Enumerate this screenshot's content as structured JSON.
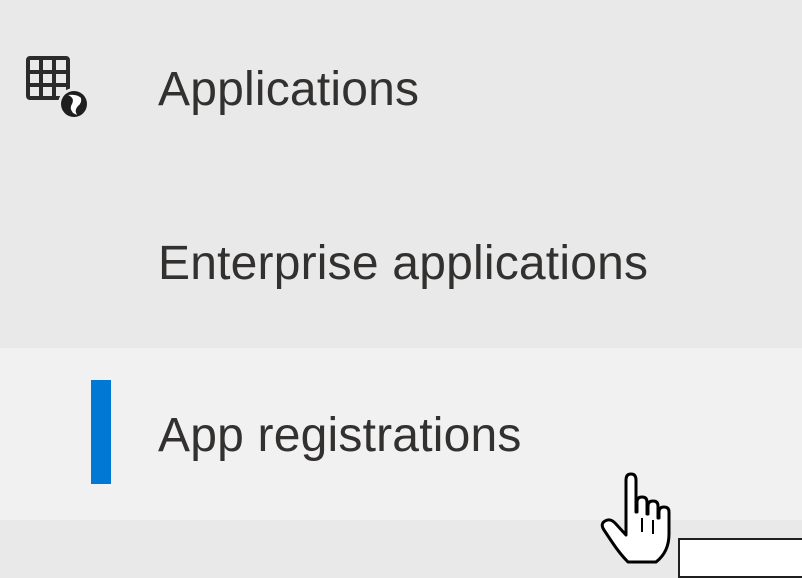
{
  "navigation": {
    "group": {
      "label": "Applications",
      "icon": "applications-globe-icon"
    },
    "items": [
      {
        "label": "Enterprise applications",
        "selected": false
      },
      {
        "label": "App registrations",
        "selected": true
      }
    ]
  },
  "colors": {
    "sidebar_background": "#e9e9e9",
    "hover_background": "#f2f1f1",
    "selection_indicator": "#0078d4",
    "text": "#323130"
  },
  "cursor": {
    "icon": "hand-pointer-cursor-icon"
  },
  "tooltip": {
    "text": ""
  }
}
